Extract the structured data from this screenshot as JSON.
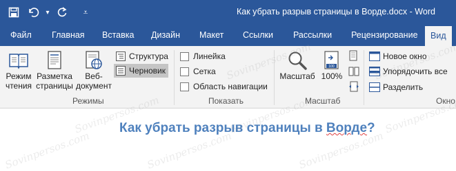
{
  "window": {
    "title": "Как убрать разрыв страницы в Ворде.docx - Word"
  },
  "qat": {
    "save_icon": "save-icon",
    "undo_icon": "undo-icon",
    "undo_dropdown": "▾",
    "redo_icon": "repeat-icon",
    "customize": "⩡"
  },
  "tabs": [
    {
      "label": "Файл"
    },
    {
      "label": "Главная"
    },
    {
      "label": "Вставка"
    },
    {
      "label": "Дизайн"
    },
    {
      "label": "Макет"
    },
    {
      "label": "Ссылки"
    },
    {
      "label": "Рассылки"
    },
    {
      "label": "Рецензирование"
    },
    {
      "label": "Вид",
      "active": true
    }
  ],
  "ribbon": {
    "views": {
      "label": "Режимы",
      "read_mode": [
        "Режим",
        "чтения"
      ],
      "print_layout": [
        "Разметка",
        "страницы"
      ],
      "web_layout": [
        "Веб-",
        "документ"
      ],
      "outline": "Структура",
      "draft": "Черновик"
    },
    "show": {
      "label": "Показать",
      "ruler": "Линейка",
      "gridlines": "Сетка",
      "nav_pane": "Область навигации"
    },
    "zoom": {
      "label": "Масштаб",
      "zoom": "Масштаб",
      "hundred": "100%",
      "badge": "100"
    },
    "window": {
      "label": "Окно",
      "new_window": "Новое окно",
      "arrange_all": "Упорядочить все",
      "split": "Разделить"
    }
  },
  "document": {
    "heading_prefix": "Как убрать разрыв страницы в ",
    "heading_word": "Ворде",
    "heading_suffix": "?"
  },
  "watermark": "Sovinpersos.com",
  "colors": {
    "accent": "#2b579a",
    "ribbon_bg": "#f3f3f3",
    "heading": "#4f81bd"
  }
}
